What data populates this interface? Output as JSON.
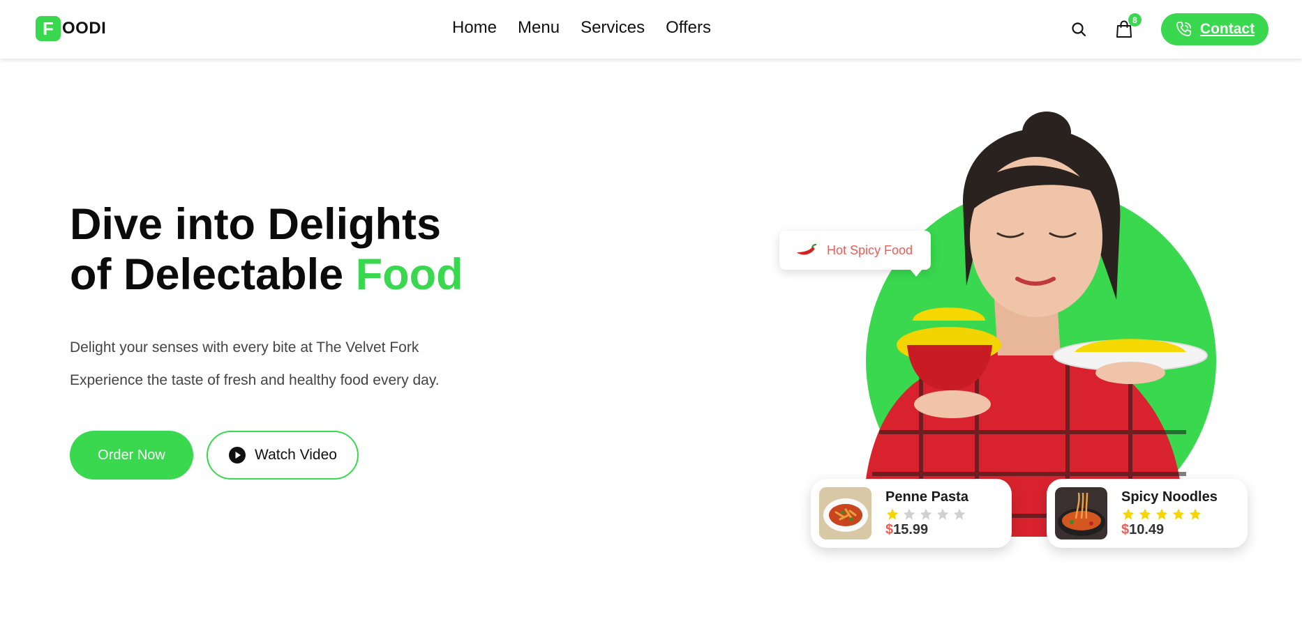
{
  "brand": {
    "mark": "F",
    "name": "OODI",
    "accent_color": "#39d84f"
  },
  "nav": {
    "items": [
      "Home",
      "Menu",
      "Services",
      "Offers"
    ]
  },
  "header": {
    "cart_count": "8",
    "contact_label": "Contact"
  },
  "hero": {
    "title_line1": "Dive into Delights",
    "title_line2_prefix": "of Delectable ",
    "title_line2_accent": "Food",
    "subtitle_1": "Delight your senses with every bite at The Velvet Fork",
    "subtitle_2": "Experience the taste of fresh and healthy food every day.",
    "order_label": "Order Now",
    "watch_label": "Watch Video"
  },
  "badge": {
    "label": "Hot Spicy Food",
    "icon": "chili-icon"
  },
  "dishes": [
    {
      "name": "Penne Pasta",
      "rating": 1,
      "max_rating": 5,
      "currency": "$",
      "price": "15.99"
    },
    {
      "name": "Spicy Noodles",
      "rating": 5,
      "max_rating": 5,
      "currency": "$",
      "price": "10.49"
    }
  ],
  "colors": {
    "accent": "#39d84f",
    "price_currency": "#e8605a",
    "star_on": "#f5d400",
    "star_off": "#d0d0d0"
  }
}
